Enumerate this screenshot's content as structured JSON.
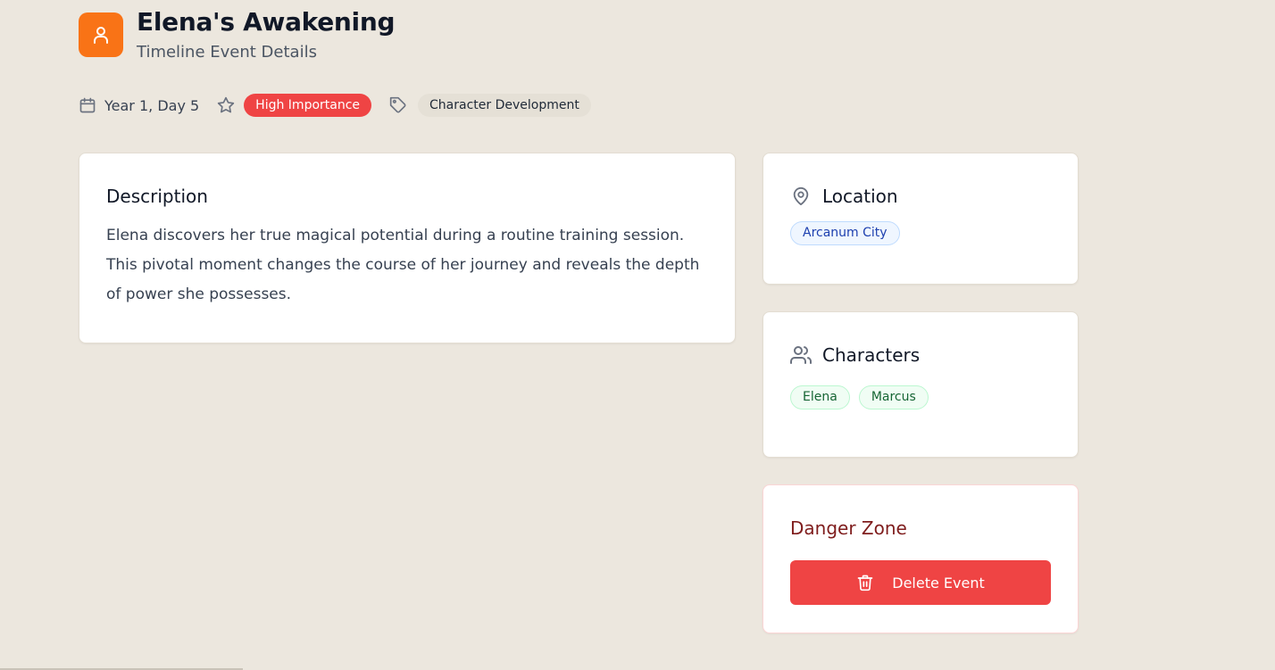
{
  "header": {
    "icon": "user-icon",
    "title": "Elena's Awakening",
    "subtitle": "Timeline Event Details",
    "accent_color": "#f97316"
  },
  "meta": {
    "date_icon": "calendar-icon",
    "date": "Year 1, Day 5",
    "importance_icon": "star-icon",
    "importance": "High Importance",
    "importance_color": "#ef4444",
    "tag_icon": "tag-icon",
    "tag": "Character Development"
  },
  "description": {
    "title": "Description",
    "text": "Elena discovers her true magical potential during a routine training session. This pivotal moment changes the course of her journey and reveals the depth of power she possesses."
  },
  "location": {
    "icon": "map-pin-icon",
    "title": "Location",
    "value": "Arcanum City"
  },
  "characters": {
    "icon": "users-icon",
    "title": "Characters",
    "items": [
      "Elena",
      "Marcus"
    ]
  },
  "danger": {
    "title": "Danger Zone",
    "delete_icon": "trash-icon",
    "delete_label": "Delete Event",
    "delete_color": "#ef4444"
  }
}
